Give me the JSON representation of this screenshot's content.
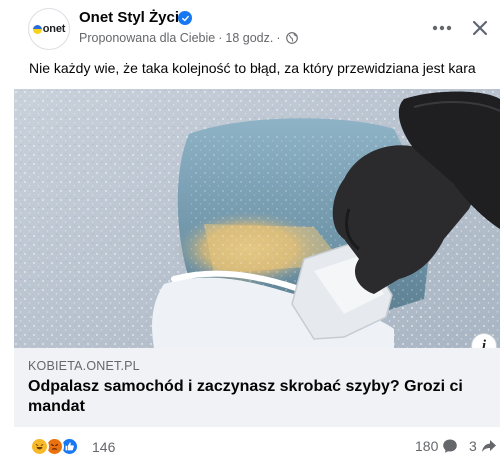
{
  "post": {
    "author": {
      "avatar_text": "onet",
      "name": "Onet Styl Życia",
      "verified": true,
      "subline_prefix": "Proponowana dla Ciebie",
      "separator": "·",
      "time": "18 godz.",
      "audience_icon": "globe-icon"
    },
    "text": "Nie każdy wie, że taka kolejność to błąd, za który przewidziana jest kara",
    "image": {
      "description_icon": "info-icon",
      "info_label": "i"
    },
    "link": {
      "domain": "KOBIETA.ONET.PL",
      "title": "Odpalasz samochód i zaczynasz skrobać szyby? Grozi ci mandat"
    },
    "stats": {
      "reaction_icons": [
        "haha-icon",
        "angry-icon",
        "like-icon"
      ],
      "reactions_count": "146",
      "comments_count": "180",
      "shares_count": "3"
    }
  },
  "colors": {
    "verified_blue": "#1877f2",
    "secondary_text": "#65676b",
    "link_box_bg": "#f0f2f5"
  }
}
